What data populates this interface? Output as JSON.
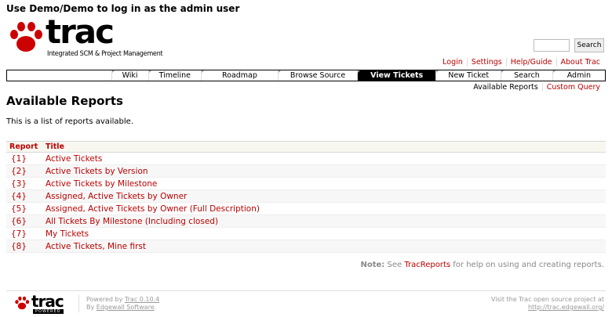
{
  "banner": "Use Demo/Demo to log in as the admin user",
  "logo": {
    "word": "trac",
    "tagline": "Integrated SCM & Project Management"
  },
  "search": {
    "button": "Search"
  },
  "metanav": [
    "Login",
    "Settings",
    "Help/Guide",
    "About Trac"
  ],
  "mainnav": [
    {
      "label": "Wiki",
      "active": false
    },
    {
      "label": "Timeline",
      "active": false
    },
    {
      "label": "Roadmap",
      "active": false
    },
    {
      "label": "Browse Source",
      "active": false
    },
    {
      "label": "View Tickets",
      "active": true
    },
    {
      "label": "New Ticket",
      "active": false
    },
    {
      "label": "Search",
      "active": false
    },
    {
      "label": "Admin",
      "active": false
    }
  ],
  "ctxtnav": [
    "Available Reports",
    "Custom Query"
  ],
  "page": {
    "title": "Available Reports",
    "intro": "This is a list of reports available."
  },
  "table": {
    "headers": [
      "Report",
      "Title"
    ],
    "rows": [
      {
        "num": "{1}",
        "title": "Active Tickets"
      },
      {
        "num": "{2}",
        "title": "Active Tickets by Version"
      },
      {
        "num": "{3}",
        "title": "Active Tickets by Milestone"
      },
      {
        "num": "{4}",
        "title": "Assigned, Active Tickets by Owner"
      },
      {
        "num": "{5}",
        "title": "Assigned, Active Tickets by Owner (Full Description)"
      },
      {
        "num": "{6}",
        "title": "All Tickets By Milestone (Including closed)"
      },
      {
        "num": "{7}",
        "title": "My Tickets"
      },
      {
        "num": "{8}",
        "title": "Active Tickets, Mine first"
      }
    ]
  },
  "note": {
    "label": "Note:",
    "pre": "See",
    "link": "TracReports",
    "post": "for help on using and creating reports."
  },
  "footer": {
    "logo_word": "trac",
    "logo_badge": "POWERED",
    "powered_pre": "Powered by",
    "powered_link": "Trac 0.10.4",
    "by_pre": "By",
    "by_link": "Edgewall Software",
    "by_post": ".",
    "visit": "Visit the Trac open source project at",
    "visit_url": "http://trac.edgewall.org/"
  },
  "colors": {
    "accent": "#bb0000",
    "active_tab": "#000000"
  }
}
